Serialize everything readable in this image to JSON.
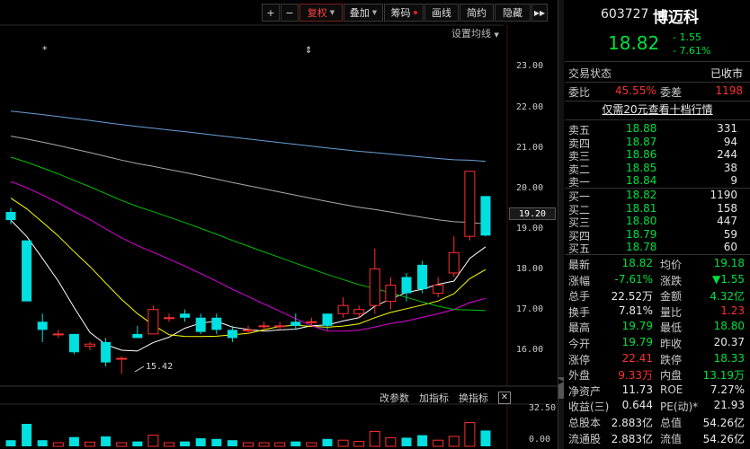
{
  "toolbar": {
    "plus": "+",
    "minus": "−",
    "fuquan": "复权",
    "diejia": "叠加",
    "chouma": "筹码",
    "huaxian": "画线",
    "jianyue": "简约",
    "yincang": "隐藏",
    "expand": "▶▶"
  },
  "settings_label": "设置均线",
  "price_axis": [
    "23.00",
    "22.00",
    "21.00",
    "20.00",
    "19.00",
    "18.00",
    "17.00",
    "16.00"
  ],
  "current_price_tag": "19.20",
  "min_price_label": "15.42",
  "sub_toolbar": {
    "params": "改参数",
    "add": "加指标",
    "switch": "换指标",
    "close": "✕"
  },
  "volume_axis": [
    "32.50",
    "0.00"
  ],
  "stock": {
    "code": "603727",
    "name": "博迈科",
    "price": "18.82",
    "change": "- 1.55",
    "change_pct": "- 7.61%"
  },
  "status": {
    "label": "交易状态",
    "value": "已收市"
  },
  "ratio": {
    "wb_label": "委比",
    "wb_value": "45.55%",
    "wc_label": "委差",
    "wc_value": "1198"
  },
  "promo": "仅需20元查看十档行情",
  "sell": [
    {
      "label": "卖五",
      "price": "18.88",
      "vol": "331"
    },
    {
      "label": "卖四",
      "price": "18.87",
      "vol": "94"
    },
    {
      "label": "卖三",
      "price": "18.86",
      "vol": "244"
    },
    {
      "label": "卖二",
      "price": "18.85",
      "vol": "38"
    },
    {
      "label": "卖一",
      "price": "18.84",
      "vol": "9"
    }
  ],
  "buy": [
    {
      "label": "买一",
      "price": "18.82",
      "vol": "1190"
    },
    {
      "label": "买二",
      "price": "18.81",
      "vol": "158"
    },
    {
      "label": "买三",
      "price": "18.80",
      "vol": "447"
    },
    {
      "label": "买四",
      "price": "18.79",
      "vol": "59"
    },
    {
      "label": "买五",
      "price": "18.78",
      "vol": "60"
    }
  ],
  "stats": [
    {
      "l1": "最新",
      "v1": "18.82",
      "c1": "g",
      "l2": "均价",
      "v2": "19.18",
      "c2": "g"
    },
    {
      "l1": "涨幅",
      "v1": "-7.61%",
      "c1": "g",
      "l2": "涨跌",
      "v2": "▼1.55",
      "c2": "g"
    },
    {
      "l1": "总手",
      "v1": "22.52万",
      "c1": "w",
      "l2": "金额",
      "v2": "4.32亿",
      "c2": "g"
    },
    {
      "l1": "换手",
      "v1": "7.81%",
      "c1": "w",
      "l2": "量比",
      "v2": "1.23",
      "c2": "r"
    },
    {
      "l1": "最高",
      "v1": "19.79",
      "c1": "g",
      "l2": "最低",
      "v2": "18.80",
      "c2": "g"
    },
    {
      "l1": "今开",
      "v1": "19.79",
      "c1": "g",
      "l2": "昨收",
      "v2": "20.37",
      "c2": "w"
    },
    {
      "l1": "涨停",
      "v1": "22.41",
      "c1": "r",
      "l2": "跌停",
      "v2": "18.33",
      "c2": "g"
    },
    {
      "l1": "外盘",
      "v1": "9.33万",
      "c1": "r",
      "l2": "内盘",
      "v2": "13.19万",
      "c2": "g"
    },
    {
      "l1": "净资产",
      "v1": "11.73",
      "c1": "w",
      "l2": "ROE",
      "v2": "7.27%",
      "c2": "w"
    },
    {
      "l1": "收益(三)",
      "v1": "0.644",
      "c1": "w",
      "l2": "PE(动)*",
      "v2": "21.93",
      "c2": "w"
    },
    {
      "l1": "总股本",
      "v1": "2.883亿",
      "c1": "w",
      "l2": "总值",
      "v2": "54.26亿",
      "c2": "w"
    },
    {
      "l1": "流通股",
      "v1": "2.883亿",
      "c1": "w",
      "l2": "流值",
      "v2": "54.26亿",
      "c2": "w"
    }
  ],
  "colors": {
    "up": "#ff3030",
    "down": "#00e0e0",
    "green": "#00e040",
    "ma5": "#ffffff",
    "ma10": "#ffff00",
    "ma20": "#e000e0",
    "ma30": "#00c000",
    "ma60": "#aaaaaa",
    "ma120": "#6aa0d8"
  },
  "chart_data": {
    "type": "candlestick",
    "yaxis_ticks": [
      23.0,
      22.0,
      21.0,
      20.0,
      19.0,
      18.0,
      17.0,
      16.0
    ],
    "ylim": [
      15.2,
      23.2
    ],
    "candles": [
      {
        "o": 19.4,
        "c": 19.2,
        "h": 19.5,
        "l": 19.1
      },
      {
        "o": 18.7,
        "c": 17.2,
        "h": 18.7,
        "l": 17.2
      },
      {
        "o": 16.7,
        "c": 16.5,
        "h": 16.9,
        "l": 16.2
      },
      {
        "o": 16.4,
        "c": 16.4,
        "h": 16.5,
        "l": 16.3
      },
      {
        "o": 16.4,
        "c": 15.95,
        "h": 16.4,
        "l": 15.9
      },
      {
        "o": 16.1,
        "c": 16.15,
        "h": 16.2,
        "l": 16.0
      },
      {
        "o": 16.2,
        "c": 15.7,
        "h": 16.3,
        "l": 15.6
      },
      {
        "o": 15.8,
        "c": 15.8,
        "h": 15.85,
        "l": 15.42
      },
      {
        "o": 16.4,
        "c": 16.3,
        "h": 16.6,
        "l": 16.3
      },
      {
        "o": 16.4,
        "c": 17.0,
        "h": 17.1,
        "l": 16.4
      },
      {
        "o": 16.8,
        "c": 16.8,
        "h": 16.9,
        "l": 16.7
      },
      {
        "o": 16.9,
        "c": 16.8,
        "h": 17.0,
        "l": 16.7
      },
      {
        "o": 16.8,
        "c": 16.45,
        "h": 16.9,
        "l": 16.4
      },
      {
        "o": 16.8,
        "c": 16.5,
        "h": 16.9,
        "l": 16.4
      },
      {
        "o": 16.5,
        "c": 16.3,
        "h": 16.6,
        "l": 16.2
      },
      {
        "o": 16.5,
        "c": 16.5,
        "h": 16.6,
        "l": 16.4
      },
      {
        "o": 16.6,
        "c": 16.6,
        "h": 16.7,
        "l": 16.5
      },
      {
        "o": 16.6,
        "c": 16.6,
        "h": 16.7,
        "l": 16.5
      },
      {
        "o": 16.7,
        "c": 16.6,
        "h": 16.9,
        "l": 16.5
      },
      {
        "o": 16.7,
        "c": 16.7,
        "h": 16.8,
        "l": 16.6
      },
      {
        "o": 16.9,
        "c": 16.6,
        "h": 16.9,
        "l": 16.5
      },
      {
        "o": 16.9,
        "c": 17.1,
        "h": 17.3,
        "l": 16.8
      },
      {
        "o": 16.9,
        "c": 17.0,
        "h": 17.1,
        "l": 16.8
      },
      {
        "o": 17.1,
        "c": 18.0,
        "h": 18.5,
        "l": 16.9
      },
      {
        "o": 17.2,
        "c": 17.6,
        "h": 17.8,
        "l": 17.0
      },
      {
        "o": 17.8,
        "c": 17.4,
        "h": 17.9,
        "l": 17.2
      },
      {
        "o": 18.1,
        "c": 17.5,
        "h": 18.2,
        "l": 17.4
      },
      {
        "o": 17.4,
        "c": 17.6,
        "h": 17.8,
        "l": 17.3
      },
      {
        "o": 17.9,
        "c": 18.4,
        "h": 18.8,
        "l": 17.8
      },
      {
        "o": 18.8,
        "c": 20.4,
        "h": 20.4,
        "l": 18.7
      },
      {
        "o": 19.79,
        "c": 18.82,
        "h": 19.79,
        "l": 18.8
      }
    ]
  }
}
